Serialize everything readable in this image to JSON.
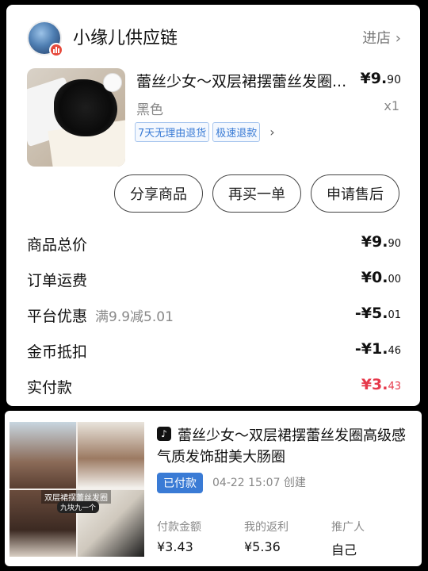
{
  "store": {
    "name": "小缘儿供应链",
    "enter_label": "进店"
  },
  "product": {
    "title": "蕾丝少女～双层裙摆蕾丝发圈...",
    "price_main": "¥9.",
    "price_cents": "90",
    "variant": "黑色",
    "quantity": "x1",
    "tags": [
      "7天无理由退货",
      "极速退款"
    ]
  },
  "actions": [
    "分享商品",
    "再买一单",
    "申请售后"
  ],
  "summary": {
    "goods_total": {
      "label": "商品总价",
      "main": "¥9.",
      "cents": "90"
    },
    "shipping": {
      "label": "订单运费",
      "main": "¥0.",
      "cents": "00"
    },
    "platform_discount": {
      "label": "平台优惠",
      "note": "满9.9减5.01",
      "main": "-¥5.",
      "cents": "01"
    },
    "coin_deduct": {
      "label": "金币抵扣",
      "main": "-¥1.",
      "cents": "46"
    },
    "paid": {
      "label": "实付款",
      "main": "¥3.",
      "cents": "43",
      "color": "#e6394b"
    }
  },
  "order_card": {
    "title": "蕾丝少女～双层裙摆蕾丝发圈高级感气质发饰甜美大肠圈",
    "status": "已付款",
    "created": "04-22 15:07 创建",
    "image_caption": "双层裙摆蕾丝发圈",
    "image_caption2": "九块九一个",
    "stats": [
      {
        "label": "付款金额",
        "value": "¥3.43"
      },
      {
        "label": "我的返利",
        "value": "¥5.36"
      },
      {
        "label": "推广人",
        "value": "自己"
      }
    ]
  },
  "icons": {
    "platform": "tiktok-icon",
    "chevron": "chevron-right-icon"
  }
}
